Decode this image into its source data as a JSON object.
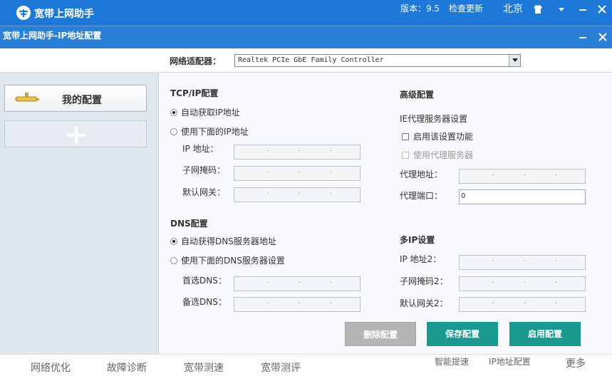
{
  "app": {
    "title": "宽带上网助手",
    "version": "版本：9.5",
    "check_update": "检查更新",
    "city": "北京"
  },
  "window": {
    "title": "宽带上网助手-IP地址配置"
  },
  "adapter": {
    "label": "网络适配器：",
    "selected": "Realtek PCIe GbE Family Controller"
  },
  "sidebar": {
    "my_config": "我的配置"
  },
  "tcpip": {
    "title": "TCP/IP配置",
    "auto_ip": "自动获取IP地址",
    "manual_ip": "使用下面的IP地址",
    "ip_label": "IP 地址：",
    "mask_label": "子网掩码：",
    "gateway_label": "默认网关："
  },
  "dns": {
    "title": "DNS配置",
    "auto_dns": "自动获得DNS服务器地址",
    "manual_dns": "使用下面的DNS服务器设置",
    "primary_label": "首选DNS：",
    "secondary_label": "备选DNS："
  },
  "advanced": {
    "title": "高级配置",
    "proxy_title": "IE代理服务器设置",
    "enable_label": "启用该设置功能",
    "use_proxy_label": "使用代理服务器",
    "proxy_addr_label": "代理地址：",
    "proxy_port_label": "代理端口：",
    "proxy_port_value": "0"
  },
  "multi_ip": {
    "title": "多IP设置",
    "ip2_label": "IP 地址2：",
    "mask2_label": "子网掩码2：",
    "gateway2_label": "默认网关2："
  },
  "buttons": {
    "delete": "删除配置",
    "save": "保存配置",
    "apply": "启用配置"
  },
  "bottom_nav": [
    "网络优化",
    "故障诊断",
    "宽带测速",
    "宽带测评",
    "智能提速",
    "IP地址配置",
    "更多"
  ],
  "colors": {
    "titlebar": "#1e78d7",
    "accent_button": "#1a9a8f",
    "disabled_button": "#b5b5b5"
  }
}
